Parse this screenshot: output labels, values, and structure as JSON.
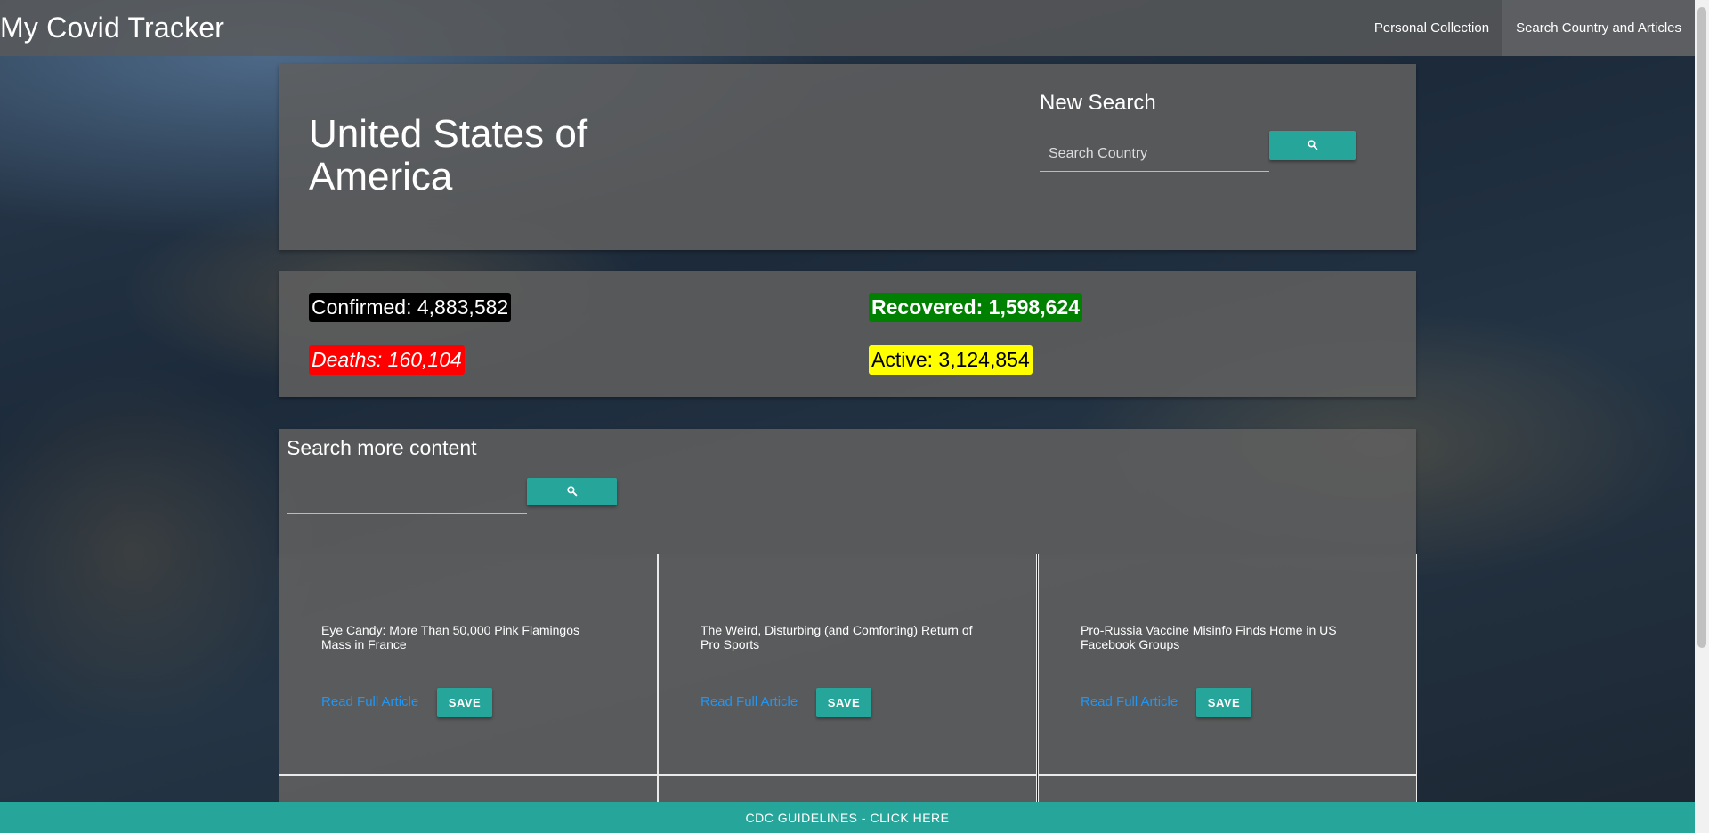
{
  "navbar": {
    "brand": "My Covid Tracker",
    "links": [
      "Personal Collection",
      "Search Country and Articles"
    ]
  },
  "country": {
    "name": "United States of America",
    "new_search_title": "New Search",
    "search_placeholder": "Search Country"
  },
  "stats": {
    "confirmed": "Confirmed: 4,883,582",
    "deaths": "Deaths: 160,104",
    "recovered": "Recovered: 1,598,624",
    "active": "Active: 3,124,854"
  },
  "content_search": {
    "title": "Search more content"
  },
  "articles": [
    {
      "title": "Eye Candy: More Than 50,000 Pink Flamingos Mass in France",
      "link": "Read Full Article",
      "save": "SAVE"
    },
    {
      "title": "The Weird, Disturbing (and Comforting) Return of Pro Sports",
      "link": "Read Full Article",
      "save": "SAVE"
    },
    {
      "title": "Pro-Russia Vaccine Misinfo Finds Home in US Facebook Groups",
      "link": "Read Full Article",
      "save": "SAVE"
    }
  ],
  "icons": {
    "search": "search-icon"
  },
  "colors": {
    "teal": "#26a69a",
    "confirmed_bg": "#000000",
    "deaths_bg": "#ff0000",
    "recovered_bg": "#008000",
    "active_bg": "#ffff00",
    "link": "#2196f3"
  },
  "footer": {
    "label": "CDC GUIDELINES - CLICK HERE"
  }
}
